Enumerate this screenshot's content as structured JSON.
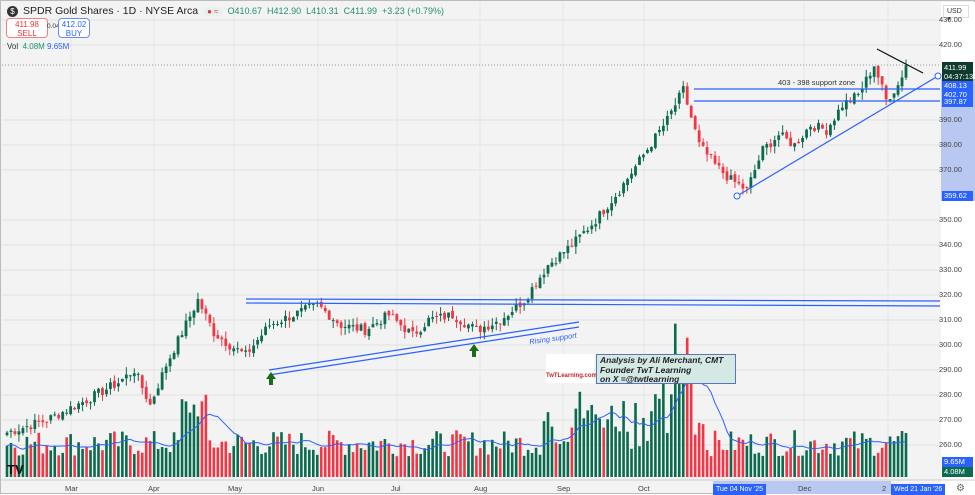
{
  "header": {
    "symbol_title": "SPDR Gold Shares · 1D · NYSE Arca",
    "open": "O410.67",
    "high": "H412.90",
    "low": "L410.31",
    "close": "C411.99",
    "change": "+3.23 (+0.79%)"
  },
  "trade": {
    "sell_price": "411.98",
    "sell_label": "SELL",
    "spread": "0.04",
    "buy_price": "412.02",
    "buy_label": "BUY"
  },
  "volume_legend": {
    "label": "Vol",
    "v1": "4.08M",
    "v2": "9.65M"
  },
  "currency": "USD",
  "annotations": {
    "support_zone": "403 - 398 support zone",
    "rising_support": "Rising support",
    "note_line1": "Analysis by Ali Merchant, CMT",
    "note_line2": "Founder TwT Learning",
    "note_line3": "on X =@twtlearning",
    "logo_text": "TwTLearning.com"
  },
  "price_tags": {
    "last": "411.99",
    "countdown": "04:37:13",
    "t1": "408.13",
    "t2": "402.70",
    "t3": "397.87",
    "t4": "359.62",
    "vol1": "9.65M",
    "vol2": "4.08M"
  },
  "date_tags": {
    "d1": "Tue 04 Nov '25",
    "d2": "Wed 21 Jan '26"
  },
  "colors": {
    "up": "#0b6b4f",
    "down": "#f23645",
    "line": "#2962ff"
  },
  "chart_data": {
    "type": "candlestick",
    "title": "SPDR Gold Shares · 1D · NYSE Arca",
    "y_ticks": [
      "430.00",
      "420.00",
      "390.00",
      "380.00",
      "370.00",
      "350.00",
      "340.00",
      "330.00",
      "320.00",
      "310.00",
      "300.00",
      "290.00",
      "280.00",
      "270.00",
      "260.00"
    ],
    "x_ticks": [
      "Mar",
      "Apr",
      "May",
      "Jun",
      "Jul",
      "Aug",
      "Sep",
      "Oct",
      "Dec",
      "2"
    ],
    "ylim": [
      257,
      430
    ],
    "close_anchors": [
      [
        0,
        265
      ],
      [
        10,
        270
      ],
      [
        20,
        278
      ],
      [
        28,
        285
      ],
      [
        32,
        290
      ],
      [
        36,
        276
      ],
      [
        40,
        292
      ],
      [
        44,
        305
      ],
      [
        48,
        318
      ],
      [
        52,
        305
      ],
      [
        56,
        300
      ],
      [
        60,
        296
      ],
      [
        66,
        308
      ],
      [
        72,
        312
      ],
      [
        78,
        316
      ],
      [
        84,
        308
      ],
      [
        90,
        306
      ],
      [
        96,
        312
      ],
      [
        102,
        304
      ],
      [
        106,
        310
      ],
      [
        112,
        312
      ],
      [
        118,
        306
      ],
      [
        124,
        310
      ],
      [
        130,
        318
      ],
      [
        136,
        332
      ],
      [
        142,
        340
      ],
      [
        148,
        350
      ],
      [
        154,
        362
      ],
      [
        160,
        376
      ],
      [
        166,
        390
      ],
      [
        170,
        402
      ],
      [
        174,
        380
      ],
      [
        178,
        372
      ],
      [
        182,
        366
      ],
      [
        186,
        362
      ],
      [
        190,
        378
      ],
      [
        194,
        384
      ],
      [
        198,
        380
      ],
      [
        202,
        388
      ],
      [
        206,
        386
      ],
      [
        210,
        396
      ],
      [
        214,
        400
      ],
      [
        218,
        412
      ],
      [
        221,
        398
      ],
      [
        224,
        404
      ],
      [
        226,
        412
      ]
    ],
    "volume_range_m": [
      0,
      30
    ]
  }
}
